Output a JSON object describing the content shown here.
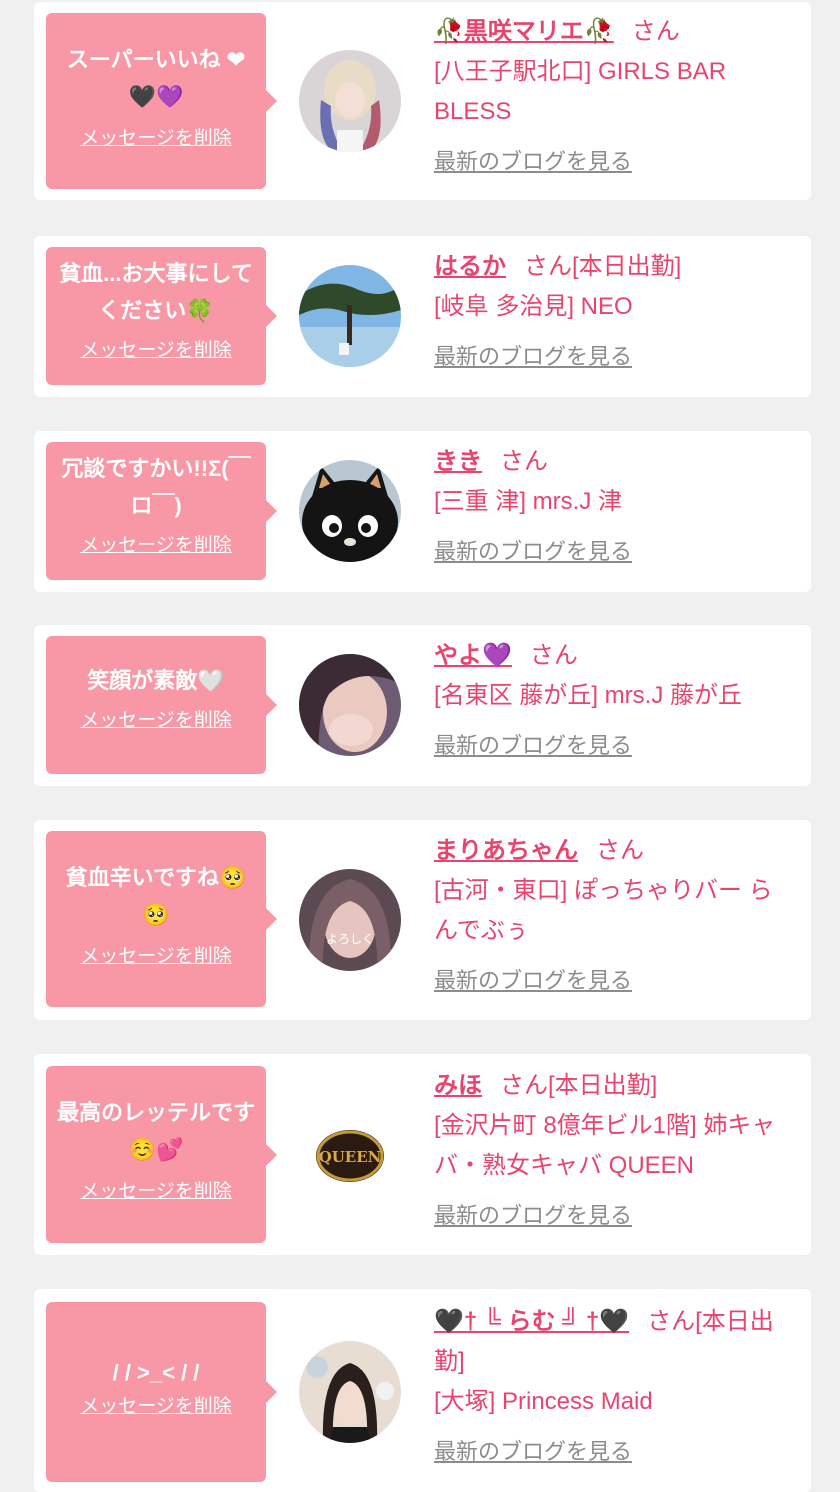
{
  "delete_label": "メッセージを削除",
  "blog_label": "最新のブログを見る",
  "san_label": "さん",
  "cards": [
    {
      "message": "スーパーいいね ❤ 🖤💜",
      "name": "🥀黒咲マリエ🥀",
      "san": "さん",
      "shop": "[八王子駅北口] GIRLS BAR BLESS"
    },
    {
      "message": "貧血...お大事にしてください🍀",
      "name": "はるか",
      "san": "さん[本日出勤]",
      "shop": "[岐阜 多治見] NEO"
    },
    {
      "message": "冗談ですかい!!Σ(￣ロ￣)",
      "name": "きき",
      "san": "さん",
      "shop": "[三重 津] mrs.J 津"
    },
    {
      "message": "笑顔が素敵🤍",
      "name": "やよ💜",
      "san": "さん",
      "shop": "[名東区 藤が丘] mrs.J 藤が丘"
    },
    {
      "message": "貧血辛いですね🥺🥺",
      "name": "まりあちゃん",
      "san": "さん",
      "shop": "[古河・東口] ぽっちゃりバー らんでぶぅ"
    },
    {
      "message": "最高のレッテルです☺️💕",
      "name": "みほ",
      "san": "さん[本日出勤]",
      "shop": "[金沢片町 8億年ビル1階] 姉キャバ・熟女キャバ QUEEN"
    },
    {
      "message": "/ / >_< / /",
      "name": "🖤† ╚ らむ ╝ †🖤",
      "san": "さん[本日出勤]",
      "shop": "[大塚] Princess Maid"
    }
  ],
  "avatar_icons": [
    "avatar-blonde-woman",
    "avatar-tree-sea",
    "avatar-black-cat",
    "avatar-woman-face",
    "avatar-woman-hair",
    "avatar-queen-logo",
    "avatar-woman-bunny"
  ],
  "colors": {
    "bubble": "#f897a6",
    "accent": "#e8446e",
    "link_gray": "#8c8c8c",
    "background": "#f0f0f0"
  }
}
